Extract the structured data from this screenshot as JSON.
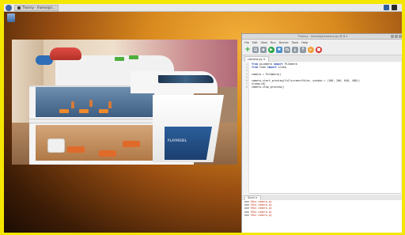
{
  "taskbar": {
    "window_item": "Thonny - /home/pi/...",
    "clock": ""
  },
  "desktop": {
    "icon_label": ""
  },
  "preview": {
    "bow_text": "PLAYMOBIL"
  },
  "ide": {
    "title": "Thonny - /home/pi/camera.py @ 8:1",
    "menu": [
      "File",
      "Edit",
      "View",
      "Run",
      "Device",
      "Tools",
      "Help"
    ],
    "tab": "camera.py ✕",
    "code_lines": [
      {
        "kw": "from",
        "rest": " picamera ",
        "kw2": "import",
        "rest2": " PiCamera"
      },
      {
        "kw": "from",
        "rest": " time ",
        "kw2": "import",
        "rest2": " sleep"
      },
      {
        "kw": "",
        "rest": "",
        "kw2": "",
        "rest2": ""
      },
      {
        "kw": "",
        "rest": "camera = PiCamera()",
        "kw2": "",
        "rest2": ""
      },
      {
        "kw": "",
        "rest": "",
        "kw2": "",
        "rest2": ""
      },
      {
        "kw": "",
        "rest": "camera.start_preview(fullscreen=False, window = (100, 200, 640, 480))",
        "kw2": "",
        "rest2": ""
      },
      {
        "kw": "",
        "rest": "sleep(10)",
        "kw2": "",
        "rest2": ""
      },
      {
        "kw": "",
        "rest": "camera.stop_preview()",
        "kw2": "",
        "rest2": ""
      }
    ],
    "shell_tab": "Shell ✕",
    "shell_lines": [
      {
        "prompt": ">>>",
        "text": " %Run camera.py"
      },
      {
        "prompt": ">>>",
        "text": " %Run camera.py"
      },
      {
        "prompt": ">>>",
        "text": " %Run camera.py"
      },
      {
        "prompt": ">>>",
        "text": " %Run camera.py"
      },
      {
        "prompt": ">>>",
        "text": " %Run camera.py"
      }
    ]
  }
}
